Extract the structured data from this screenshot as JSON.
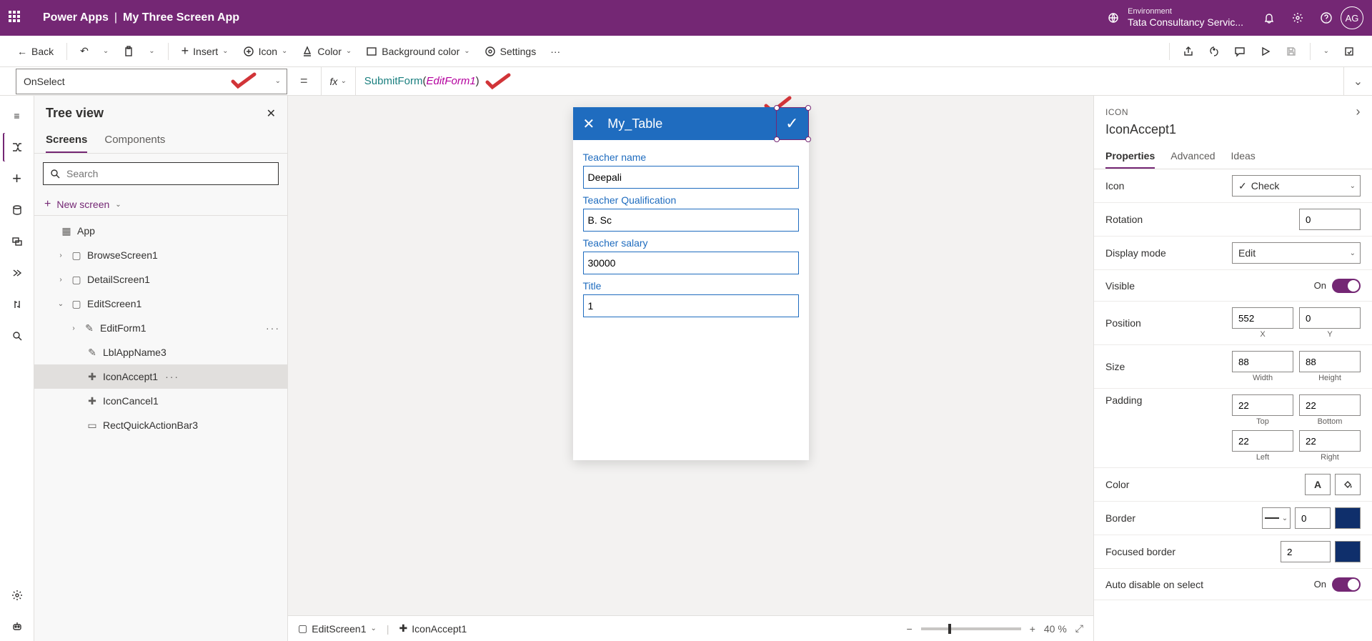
{
  "header": {
    "brand": "Power Apps",
    "app_name": "My Three Screen App",
    "env_label": "Environment",
    "env_name": "Tata Consultancy Servic...",
    "avatar": "AG"
  },
  "toolbar": {
    "back": "Back",
    "insert": "Insert",
    "icon": "Icon",
    "color": "Color",
    "bgcolor": "Background color",
    "settings": "Settings"
  },
  "formula": {
    "property": "OnSelect",
    "fn": "SubmitForm",
    "arg": "EditForm1"
  },
  "tree": {
    "title": "Tree view",
    "tabs": {
      "screens": "Screens",
      "components": "Components"
    },
    "search_placeholder": "Search",
    "new_screen": "New screen",
    "nodes": {
      "app": "App",
      "browse": "BrowseScreen1",
      "detail": "DetailScreen1",
      "edit": "EditScreen1",
      "editform": "EditForm1",
      "lbl": "LblAppName3",
      "accept": "IconAccept1",
      "cancel": "IconCancel1",
      "rect": "RectQuickActionBar3"
    }
  },
  "canvas": {
    "title": "My_Table",
    "fields": [
      {
        "label": "Teacher name",
        "value": "Deepali"
      },
      {
        "label": "Teacher Qualification",
        "value": "B. Sc"
      },
      {
        "label": "Teacher salary",
        "value": "30000"
      },
      {
        "label": "Title",
        "value": "1"
      }
    ],
    "footer": {
      "screen": "EditScreen1",
      "control": "IconAccept1",
      "zoom": "40  %"
    }
  },
  "props": {
    "type": "ICON",
    "name": "IconAccept1",
    "tabs": {
      "p": "Properties",
      "a": "Advanced",
      "i": "Ideas"
    },
    "icon_label": "Icon",
    "icon_value": "Check",
    "rotation_label": "Rotation",
    "rotation_value": "0",
    "display_label": "Display mode",
    "display_value": "Edit",
    "visible_label": "Visible",
    "visible_on": "On",
    "position_label": "Position",
    "pos_x": "552",
    "pos_y": "0",
    "x": "X",
    "y": "Y",
    "size_label": "Size",
    "w": "88",
    "h": "88",
    "wl": "Width",
    "hl": "Height",
    "padding_label": "Padding",
    "pt": "22",
    "pb": "22",
    "pl": "22",
    "pr": "22",
    "ptl": "Top",
    "pbl": "Bottom",
    "pll": "Left",
    "prl": "Right",
    "color_label": "Color",
    "border_label": "Border",
    "border_value": "0",
    "fborder_label": "Focused border",
    "fborder_value": "2",
    "autodisable_label": "Auto disable on select",
    "autodisable_on": "On"
  }
}
